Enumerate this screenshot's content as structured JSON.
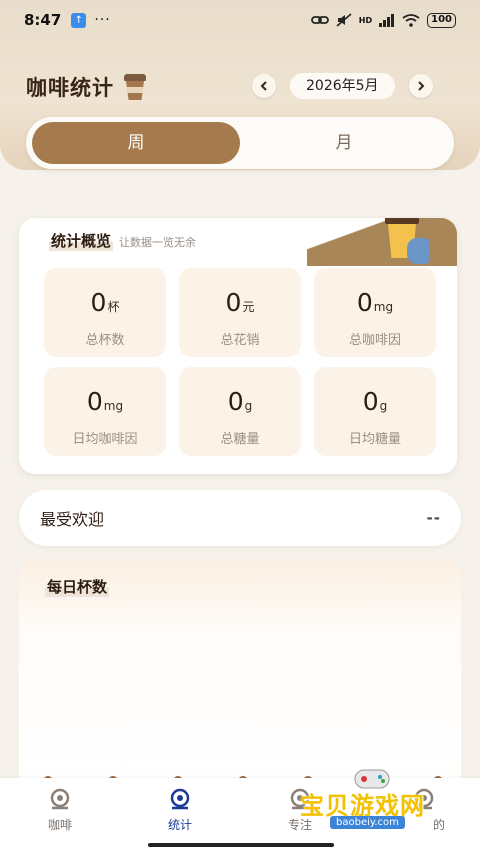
{
  "status_bar": {
    "time": "8:47",
    "dots": "···",
    "network": "HD",
    "battery": "100"
  },
  "header": {
    "title": "咖啡统计",
    "prev_icon": "chevron-left-icon",
    "next_icon": "chevron-right-icon",
    "date": "2026年5月"
  },
  "segment": {
    "week_label": "周",
    "month_label": "月",
    "selected": "周"
  },
  "overview": {
    "title": "统计概览",
    "subtitle": "让数据一览无余",
    "stats": [
      {
        "value": "0",
        "unit": "杯",
        "label": "总杯数"
      },
      {
        "value": "0",
        "unit": "元",
        "label": "总花销"
      },
      {
        "value": "0",
        "unit": "mg",
        "label": "总咖啡因"
      },
      {
        "value": "0",
        "unit": "mg",
        "label": "日均咖啡因"
      },
      {
        "value": "0",
        "unit": "g",
        "label": "总糖量"
      },
      {
        "value": "0",
        "unit": "g",
        "label": "日均糖量"
      }
    ]
  },
  "favorite": {
    "title": "最受欢迎",
    "value": "--"
  },
  "daily": {
    "title": "每日杯数"
  },
  "tabbar": {
    "items": [
      {
        "label": "咖啡",
        "icon": "coffee-cup-icon",
        "active": false
      },
      {
        "label": "统计",
        "icon": "stats-icon",
        "active": true
      },
      {
        "label": "专注",
        "icon": "focus-icon",
        "active": false
      },
      {
        "label": "的",
        "icon": "profile-icon",
        "active": false
      }
    ]
  },
  "watermark": {
    "text": "宝贝游戏网",
    "url": "baobeiy.com"
  },
  "colors": {
    "accent": "#a57a4c",
    "active_tab": "#1d3b96",
    "card_bg": "#fcf3e8"
  }
}
